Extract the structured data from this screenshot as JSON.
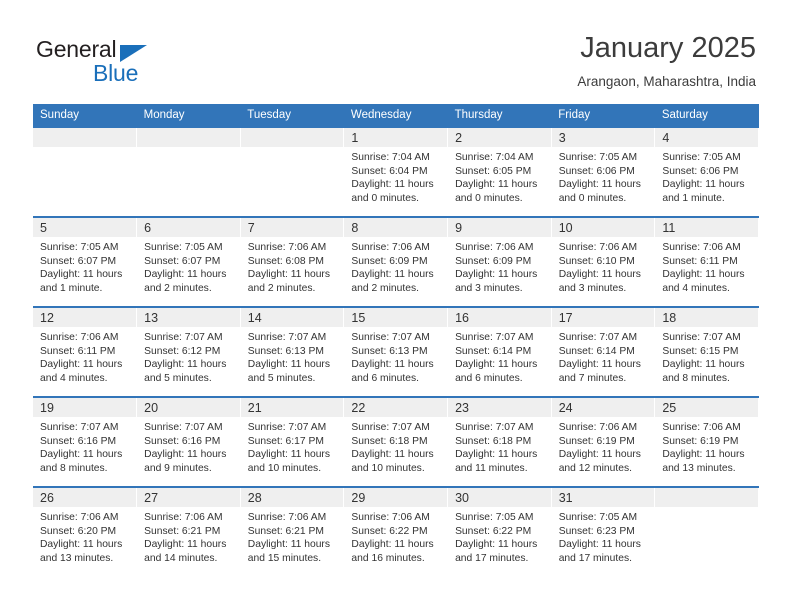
{
  "brand": {
    "name_part1": "General",
    "name_part2": "Blue"
  },
  "header": {
    "title": "January 2025",
    "subtitle": "Arangaon, Maharashtra, India"
  },
  "colors": {
    "header_blue": "#3275b9",
    "brand_blue": "#1a6fba",
    "daynum_band": "#efefef",
    "text": "#333333"
  },
  "weekday_headers": [
    "Sunday",
    "Monday",
    "Tuesday",
    "Wednesday",
    "Thursday",
    "Friday",
    "Saturday"
  ],
  "weeks": [
    [
      {
        "day": "",
        "empty": true
      },
      {
        "day": "",
        "empty": true
      },
      {
        "day": "",
        "empty": true
      },
      {
        "day": "1",
        "sunrise": "Sunrise: 7:04 AM",
        "sunset": "Sunset: 6:04 PM",
        "daylight": "Daylight: 11 hours and 0 minutes."
      },
      {
        "day": "2",
        "sunrise": "Sunrise: 7:04 AM",
        "sunset": "Sunset: 6:05 PM",
        "daylight": "Daylight: 11 hours and 0 minutes."
      },
      {
        "day": "3",
        "sunrise": "Sunrise: 7:05 AM",
        "sunset": "Sunset: 6:06 PM",
        "daylight": "Daylight: 11 hours and 0 minutes."
      },
      {
        "day": "4",
        "sunrise": "Sunrise: 7:05 AM",
        "sunset": "Sunset: 6:06 PM",
        "daylight": "Daylight: 11 hours and 1 minute."
      }
    ],
    [
      {
        "day": "5",
        "sunrise": "Sunrise: 7:05 AM",
        "sunset": "Sunset: 6:07 PM",
        "daylight": "Daylight: 11 hours and 1 minute."
      },
      {
        "day": "6",
        "sunrise": "Sunrise: 7:05 AM",
        "sunset": "Sunset: 6:07 PM",
        "daylight": "Daylight: 11 hours and 2 minutes."
      },
      {
        "day": "7",
        "sunrise": "Sunrise: 7:06 AM",
        "sunset": "Sunset: 6:08 PM",
        "daylight": "Daylight: 11 hours and 2 minutes."
      },
      {
        "day": "8",
        "sunrise": "Sunrise: 7:06 AM",
        "sunset": "Sunset: 6:09 PM",
        "daylight": "Daylight: 11 hours and 2 minutes."
      },
      {
        "day": "9",
        "sunrise": "Sunrise: 7:06 AM",
        "sunset": "Sunset: 6:09 PM",
        "daylight": "Daylight: 11 hours and 3 minutes."
      },
      {
        "day": "10",
        "sunrise": "Sunrise: 7:06 AM",
        "sunset": "Sunset: 6:10 PM",
        "daylight": "Daylight: 11 hours and 3 minutes."
      },
      {
        "day": "11",
        "sunrise": "Sunrise: 7:06 AM",
        "sunset": "Sunset: 6:11 PM",
        "daylight": "Daylight: 11 hours and 4 minutes."
      }
    ],
    [
      {
        "day": "12",
        "sunrise": "Sunrise: 7:06 AM",
        "sunset": "Sunset: 6:11 PM",
        "daylight": "Daylight: 11 hours and 4 minutes."
      },
      {
        "day": "13",
        "sunrise": "Sunrise: 7:07 AM",
        "sunset": "Sunset: 6:12 PM",
        "daylight": "Daylight: 11 hours and 5 minutes."
      },
      {
        "day": "14",
        "sunrise": "Sunrise: 7:07 AM",
        "sunset": "Sunset: 6:13 PM",
        "daylight": "Daylight: 11 hours and 5 minutes."
      },
      {
        "day": "15",
        "sunrise": "Sunrise: 7:07 AM",
        "sunset": "Sunset: 6:13 PM",
        "daylight": "Daylight: 11 hours and 6 minutes."
      },
      {
        "day": "16",
        "sunrise": "Sunrise: 7:07 AM",
        "sunset": "Sunset: 6:14 PM",
        "daylight": "Daylight: 11 hours and 6 minutes."
      },
      {
        "day": "17",
        "sunrise": "Sunrise: 7:07 AM",
        "sunset": "Sunset: 6:14 PM",
        "daylight": "Daylight: 11 hours and 7 minutes."
      },
      {
        "day": "18",
        "sunrise": "Sunrise: 7:07 AM",
        "sunset": "Sunset: 6:15 PM",
        "daylight": "Daylight: 11 hours and 8 minutes."
      }
    ],
    [
      {
        "day": "19",
        "sunrise": "Sunrise: 7:07 AM",
        "sunset": "Sunset: 6:16 PM",
        "daylight": "Daylight: 11 hours and 8 minutes."
      },
      {
        "day": "20",
        "sunrise": "Sunrise: 7:07 AM",
        "sunset": "Sunset: 6:16 PM",
        "daylight": "Daylight: 11 hours and 9 minutes."
      },
      {
        "day": "21",
        "sunrise": "Sunrise: 7:07 AM",
        "sunset": "Sunset: 6:17 PM",
        "daylight": "Daylight: 11 hours and 10 minutes."
      },
      {
        "day": "22",
        "sunrise": "Sunrise: 7:07 AM",
        "sunset": "Sunset: 6:18 PM",
        "daylight": "Daylight: 11 hours and 10 minutes."
      },
      {
        "day": "23",
        "sunrise": "Sunrise: 7:07 AM",
        "sunset": "Sunset: 6:18 PM",
        "daylight": "Daylight: 11 hours and 11 minutes."
      },
      {
        "day": "24",
        "sunrise": "Sunrise: 7:06 AM",
        "sunset": "Sunset: 6:19 PM",
        "daylight": "Daylight: 11 hours and 12 minutes."
      },
      {
        "day": "25",
        "sunrise": "Sunrise: 7:06 AM",
        "sunset": "Sunset: 6:19 PM",
        "daylight": "Daylight: 11 hours and 13 minutes."
      }
    ],
    [
      {
        "day": "26",
        "sunrise": "Sunrise: 7:06 AM",
        "sunset": "Sunset: 6:20 PM",
        "daylight": "Daylight: 11 hours and 13 minutes."
      },
      {
        "day": "27",
        "sunrise": "Sunrise: 7:06 AM",
        "sunset": "Sunset: 6:21 PM",
        "daylight": "Daylight: 11 hours and 14 minutes."
      },
      {
        "day": "28",
        "sunrise": "Sunrise: 7:06 AM",
        "sunset": "Sunset: 6:21 PM",
        "daylight": "Daylight: 11 hours and 15 minutes."
      },
      {
        "day": "29",
        "sunrise": "Sunrise: 7:06 AM",
        "sunset": "Sunset: 6:22 PM",
        "daylight": "Daylight: 11 hours and 16 minutes."
      },
      {
        "day": "30",
        "sunrise": "Sunrise: 7:05 AM",
        "sunset": "Sunset: 6:22 PM",
        "daylight": "Daylight: 11 hours and 17 minutes."
      },
      {
        "day": "31",
        "sunrise": "Sunrise: 7:05 AM",
        "sunset": "Sunset: 6:23 PM",
        "daylight": "Daylight: 11 hours and 17 minutes."
      },
      {
        "day": "",
        "empty": true
      }
    ]
  ]
}
